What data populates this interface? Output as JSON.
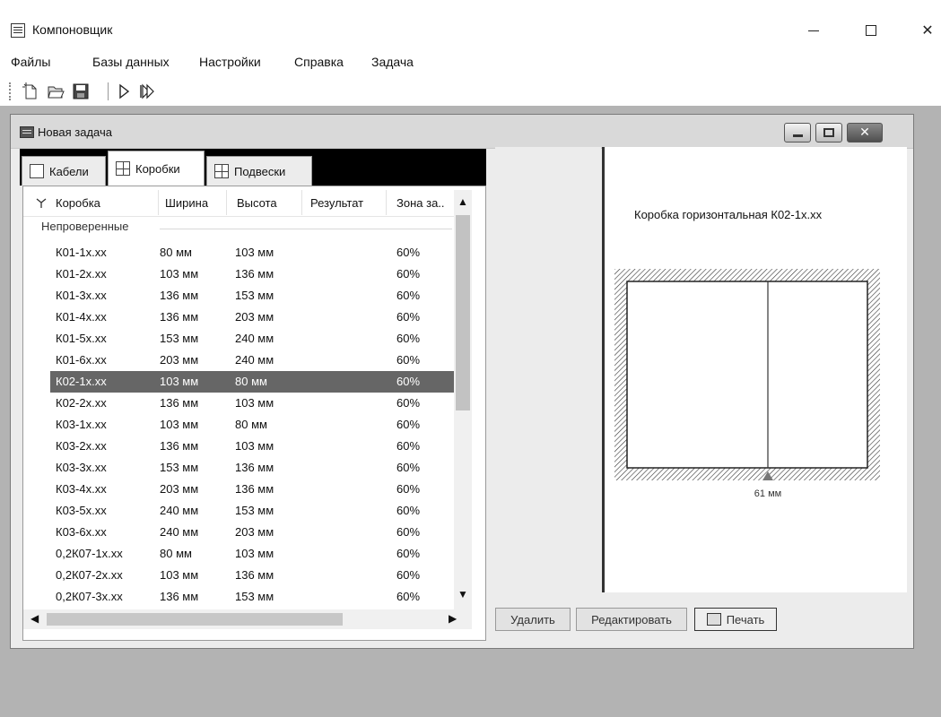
{
  "app": {
    "title": "Компоновщик",
    "window_controls": {
      "minimize": "—",
      "maximize": "☐",
      "close": "✕"
    }
  },
  "menu": [
    "Файлы",
    "Базы данных",
    "Настройки",
    "Справка",
    "Задача"
  ],
  "toolbar": {
    "icons": [
      "new-file-icon",
      "open-folder-icon",
      "save-icon",
      "run-icon",
      "run-all-icon"
    ]
  },
  "child_window": {
    "title": "Новая задача",
    "tabs": [
      {
        "label": "Кабели",
        "icon": "cable-icon"
      },
      {
        "label": "Коробки",
        "icon": "box-grid-icon",
        "selected": true
      },
      {
        "label": "Подвески",
        "icon": "hanger-icon"
      }
    ],
    "list": {
      "columns": [
        "Коробка",
        "Ширина",
        "Высота",
        "Результат",
        "Зона за.."
      ],
      "group": "Непроверенные",
      "rows": [
        [
          "К01-1x.xx",
          "80 мм",
          "103 мм",
          "",
          "60%"
        ],
        [
          "К01-2x.xx",
          "103 мм",
          "136 мм",
          "",
          "60%"
        ],
        [
          "К01-3x.xx",
          "136 мм",
          "153 мм",
          "",
          "60%"
        ],
        [
          "К01-4x.xx",
          "136 мм",
          "203 мм",
          "",
          "60%"
        ],
        [
          "К01-5x.xx",
          "153 мм",
          "240 мм",
          "",
          "60%"
        ],
        [
          "К01-6x.xx",
          "203 мм",
          "240 мм",
          "",
          "60%"
        ],
        [
          "К02-1x.xx",
          "103 мм",
          "80 мм",
          "",
          "60%"
        ],
        [
          "К02-2x.xx",
          "136 мм",
          "103 мм",
          "",
          "60%"
        ],
        [
          "К03-1x.xx",
          "103 мм",
          "80 мм",
          "",
          "60%"
        ],
        [
          "К03-2x.xx",
          "136 мм",
          "103 мм",
          "",
          "60%"
        ],
        [
          "К03-3x.xx",
          "153 мм",
          "136 мм",
          "",
          "60%"
        ],
        [
          "К03-4x.xx",
          "203 мм",
          "136 мм",
          "",
          "60%"
        ],
        [
          "К03-5x.xx",
          "240 мм",
          "153 мм",
          "",
          "60%"
        ],
        [
          "К03-6x.xx",
          "240 мм",
          "203 мм",
          "",
          "60%"
        ],
        [
          "0,2К07-1x.xx",
          "80 мм",
          "103 мм",
          "",
          "60%"
        ],
        [
          "0,2К07-2x.xx",
          "103 мм",
          "136 мм",
          "",
          "60%"
        ],
        [
          "0,2К07-3x.xx",
          "136 мм",
          "153 мм",
          "",
          "60%"
        ]
      ],
      "selected_index": 6
    },
    "preview": {
      "title": "Коробка горизонтальная К02-1x.xx",
      "dimension_label": "61 мм"
    },
    "buttons": {
      "delete": "Удалить",
      "edit": "Редактировать",
      "print": "Печать"
    }
  }
}
